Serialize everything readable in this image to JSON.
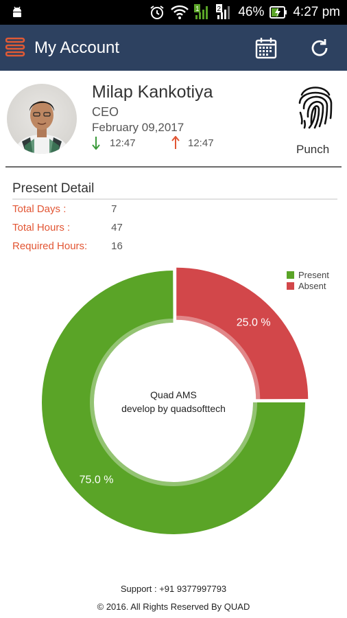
{
  "status_bar": {
    "battery_percent": "46%",
    "time": "4:27 pm",
    "signal_label": "2"
  },
  "app_bar": {
    "title": "My Account",
    "brand_color": "#2d4160",
    "icons": [
      "menu-icon",
      "calendar-icon",
      "refresh-icon"
    ]
  },
  "profile": {
    "name": "Milap Kankotiya",
    "role": "CEO",
    "date": "February 09,2017",
    "time_in": "12:47",
    "time_out": "12:47",
    "punch_label": "Punch"
  },
  "present_detail": {
    "title": "Present Detail",
    "rows": [
      {
        "label": "Total Days :",
        "value": "7"
      },
      {
        "label": "Total Hours :",
        "value": "47"
      },
      {
        "label": "Required Hours:",
        "value": "16"
      }
    ]
  },
  "chart_data": {
    "type": "pie",
    "categories": [
      "Present",
      "Absent"
    ],
    "values": [
      75.0,
      25.0
    ],
    "value_labels": [
      "75.0 %",
      "25.0 %"
    ],
    "colors": [
      "#5aa427",
      "#d2474a"
    ],
    "center_text": [
      "Quad AMS",
      "develop by quadsofttech"
    ],
    "legend_position": "top-right",
    "donut": true
  },
  "footer": {
    "support": "Support : +91 9377997793",
    "copyright": "© 2016. All Rights Reserved By QUAD"
  }
}
